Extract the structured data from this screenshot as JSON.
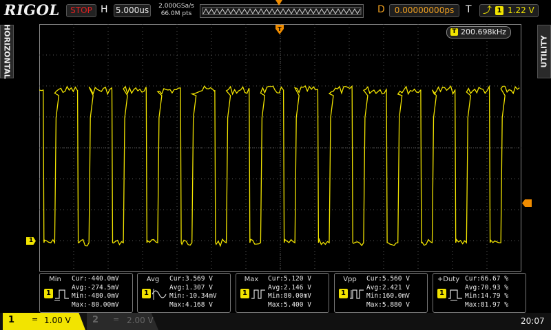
{
  "header": {
    "brand": "RIGOL",
    "run_state": "STOP",
    "timebase_label": "H",
    "timebase_value": "5.000us",
    "sample_rate": "2.000GSa/s",
    "memory_depth": "66.0M pts",
    "delay_label": "D",
    "delay_value": "0.00000000ps",
    "trigger_label": "T",
    "trigger_channel": "1",
    "trigger_level": "1.22 V"
  },
  "side_tabs": {
    "left": "HORIZONTAL",
    "right": "UTILITY"
  },
  "screen": {
    "frequency_badge": "T",
    "frequency_value": "200.698kHz",
    "ch1_marker": "1"
  },
  "measurements": [
    {
      "name": "Min",
      "badge": "1",
      "cur": "Cur:-440.0mV",
      "avg": "Avg:-274.5mV",
      "min": "Min:-480.0mV",
      "max": "Max:-80.00mV"
    },
    {
      "name": "Avg",
      "badge": "1",
      "cur": "Cur:3.569 V",
      "avg": "Avg:1.307 V",
      "min": "Min:-10.34mV",
      "max": "Max:4.168 V"
    },
    {
      "name": "Max",
      "badge": "1",
      "cur": "Cur:5.120 V",
      "avg": "Avg:2.146 V",
      "min": "Min:80.00mV",
      "max": "Max:5.400 V"
    },
    {
      "name": "Vpp",
      "badge": "1",
      "cur": "Cur:5.560 V",
      "avg": "Avg:2.421 V",
      "min": "Min:160.0mV",
      "max": "Max:5.880 V"
    },
    {
      "name": "+Duty",
      "badge": "1",
      "cur": "Cur:66.67 %",
      "avg": "Avg:70.93 %",
      "min": "Min:14.79 %",
      "max": "Max:81.97 %"
    }
  ],
  "channels": [
    {
      "number": "1",
      "coupling": "=",
      "scale": "1.00 V",
      "active": true
    },
    {
      "number": "2",
      "coupling": "=",
      "scale": "2.00 V",
      "active": false
    }
  ],
  "status": {
    "clock": "20:07"
  },
  "colors": {
    "ch1": "#f2e400",
    "trigger": "#f08c00",
    "stop": "#e02020",
    "grid": "#5a5a5a"
  },
  "waveform": {
    "high_level_v": 5.0,
    "low_level_v": -0.4,
    "volts_per_div": 1.0,
    "time_per_div_us": 5.0,
    "duty_percent": 66.67,
    "frequency_khz": 200.698
  }
}
